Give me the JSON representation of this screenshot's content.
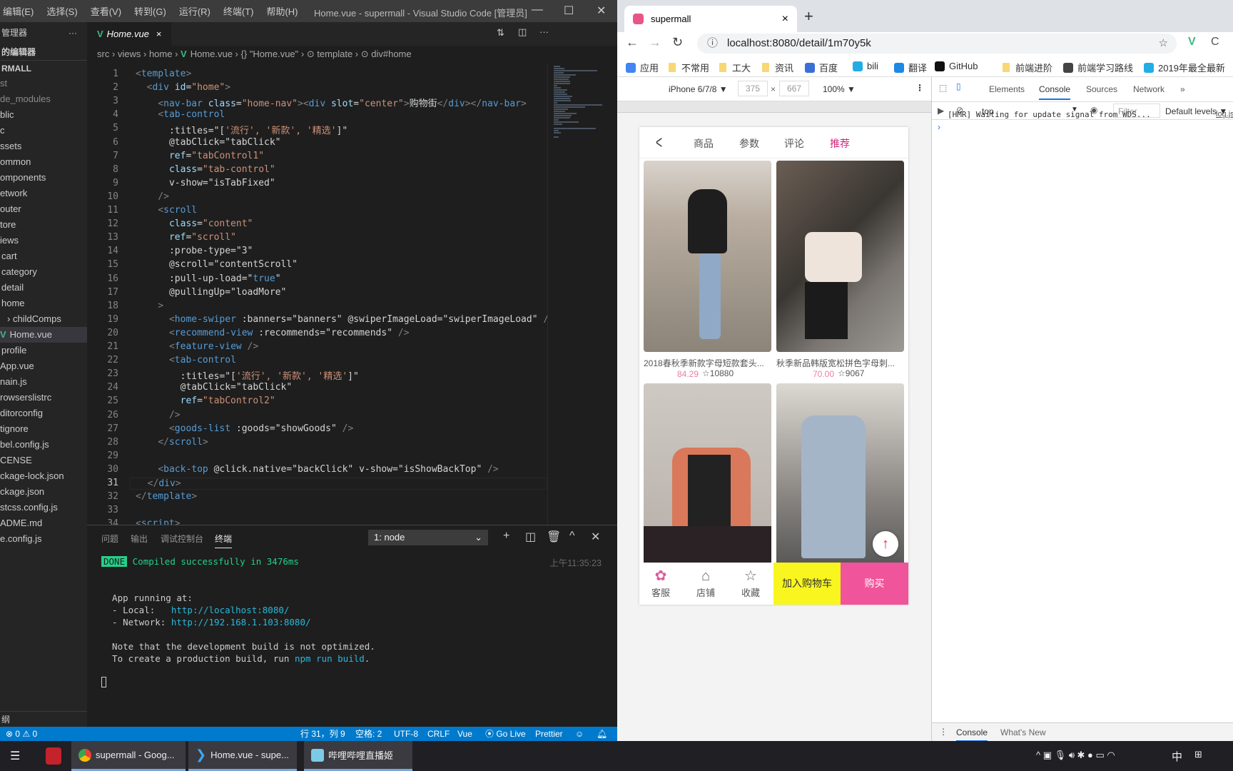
{
  "vscode": {
    "menu": [
      "编辑(E)",
      "选择(S)",
      "查看(V)",
      "转到(G)",
      "运行(R)",
      "终端(T)",
      "帮助(H)"
    ],
    "window_title": "Home.vue - supermall - Visual Studio Code [管理员]",
    "sidebar": {
      "header": "管理器",
      "more": "···",
      "open_editors": "的编辑器",
      "project": "RMALL",
      "items": [
        "st",
        "de_modules",
        "blic",
        "c",
        "ssets",
        "ommon",
        "omponents",
        "etwork",
        "outer",
        "tore",
        "iews",
        "cart",
        "category",
        "detail",
        "home",
        "childComps",
        "Home.vue",
        "profile",
        "App.vue",
        "nain.js",
        "rowserslistrc",
        "ditorconfig",
        "tignore",
        "bel.config.js",
        "CENSE",
        "ckage-lock.json",
        "ckage.json",
        "stcss.config.js",
        "ADME.md",
        "e.config.js"
      ],
      "bottom": "纲"
    },
    "tab": {
      "label": "Home.vue",
      "close": "×"
    },
    "breadcrumb": "src › views › home › ",
    "breadcrumb2": "Home.vue › {} \"Home.vue\" › ⊙ template › ⊙ div#home",
    "current_line": 31,
    "lines": [
      [
        [
          "p",
          "<"
        ],
        [
          "t",
          "template"
        ],
        [
          "p",
          ">"
        ]
      ],
      [
        [
          "x",
          "  "
        ],
        [
          "p",
          "<"
        ],
        [
          "t",
          "div"
        ],
        [
          "a",
          " id"
        ],
        [
          "x",
          "="
        ],
        [
          "s",
          "\"home\""
        ],
        [
          "p",
          ">"
        ]
      ],
      [
        [
          "x",
          "    "
        ],
        [
          "p",
          "<"
        ],
        [
          "t",
          "nav-bar"
        ],
        [
          "a",
          " class"
        ],
        [
          "x",
          "="
        ],
        [
          "s",
          "\"home-nav\""
        ],
        [
          "p",
          "><"
        ],
        [
          "t",
          "div"
        ],
        [
          "a",
          " slot"
        ],
        [
          "x",
          "="
        ],
        [
          "s",
          "\"center\""
        ],
        [
          "p",
          ">"
        ],
        [
          "x",
          "购物街"
        ],
        [
          "p",
          "</"
        ],
        [
          "t",
          "div"
        ],
        [
          "p",
          "></"
        ],
        [
          "t",
          "nav-bar"
        ],
        [
          "p",
          ">"
        ]
      ],
      [
        [
          "x",
          "    "
        ],
        [
          "p",
          "<"
        ],
        [
          "t",
          "tab-control"
        ]
      ],
      [
        [
          "x",
          "      :titles=\"["
        ],
        [
          "s",
          "'流行', '新款', '精选'"
        ],
        [
          "x",
          "]\""
        ]
      ],
      [
        [
          "x",
          "      @tabClick=\"tabClick\""
        ]
      ],
      [
        [
          "a",
          "      ref"
        ],
        [
          "x",
          "="
        ],
        [
          "s",
          "\"tabControl1\""
        ]
      ],
      [
        [
          "a",
          "      class"
        ],
        [
          "x",
          "="
        ],
        [
          "s",
          "\"tab-control\""
        ]
      ],
      [
        [
          "x",
          "      v-show=\"isTabFixed\""
        ]
      ],
      [
        [
          "p",
          "    />"
        ]
      ],
      [
        [
          "x",
          "    "
        ],
        [
          "p",
          "<"
        ],
        [
          "t",
          "scroll"
        ]
      ],
      [
        [
          "a",
          "      class"
        ],
        [
          "x",
          "="
        ],
        [
          "s",
          "\"content\""
        ]
      ],
      [
        [
          "a",
          "      ref"
        ],
        [
          "x",
          "="
        ],
        [
          "s",
          "\"scroll\""
        ]
      ],
      [
        [
          "x",
          "      :probe-type=\"3\""
        ]
      ],
      [
        [
          "x",
          "      @scroll=\"contentScroll\""
        ]
      ],
      [
        [
          "x",
          "      :pull-up-load=\""
        ],
        [
          "t",
          "true"
        ],
        [
          "x",
          "\""
        ]
      ],
      [
        [
          "x",
          "      @pullingUp=\"loadMore\""
        ]
      ],
      [
        [
          "p",
          "    >"
        ]
      ],
      [
        [
          "x",
          "      "
        ],
        [
          "p",
          "<"
        ],
        [
          "t",
          "home-swiper"
        ],
        [
          "x",
          " :banners=\"banners\" @swiperImageLoad=\"swiperImageLoad\" "
        ],
        [
          "p",
          "/>"
        ]
      ],
      [
        [
          "x",
          "      "
        ],
        [
          "p",
          "<"
        ],
        [
          "t",
          "recommend-view"
        ],
        [
          "x",
          " :recommends=\"recommends\" "
        ],
        [
          "p",
          "/>"
        ]
      ],
      [
        [
          "x",
          "      "
        ],
        [
          "p",
          "<"
        ],
        [
          "t",
          "feature-view"
        ],
        [
          "p",
          " />"
        ]
      ],
      [
        [
          "x",
          "      "
        ],
        [
          "p",
          "<"
        ],
        [
          "t",
          "tab-control"
        ]
      ],
      [
        [
          "x",
          "        :titles=\"["
        ],
        [
          "s",
          "'流行', '新款', '精选'"
        ],
        [
          "x",
          "]\""
        ]
      ],
      [
        [
          "x",
          "        @tabClick=\"tabClick\""
        ]
      ],
      [
        [
          "a",
          "        ref"
        ],
        [
          "x",
          "="
        ],
        [
          "s",
          "\"tabControl2\""
        ]
      ],
      [
        [
          "p",
          "      />"
        ]
      ],
      [
        [
          "x",
          "      "
        ],
        [
          "p",
          "<"
        ],
        [
          "t",
          "goods-list"
        ],
        [
          "x",
          " :goods=\"showGoods\" "
        ],
        [
          "p",
          "/>"
        ]
      ],
      [
        [
          "x",
          "    "
        ],
        [
          "p",
          "</"
        ],
        [
          "t",
          "scroll"
        ],
        [
          "p",
          ">"
        ]
      ],
      [],
      [
        [
          "x",
          "    "
        ],
        [
          "p",
          "<"
        ],
        [
          "t",
          "back-top"
        ],
        [
          "x",
          " @click.native=\"backClick\" v-show=\"isShowBackTop\" "
        ],
        [
          "p",
          "/>"
        ]
      ],
      [
        [
          "x",
          "  "
        ],
        [
          "p",
          "</"
        ],
        [
          "t",
          "div"
        ],
        [
          "p",
          ">"
        ]
      ],
      [
        [
          "p",
          "</"
        ],
        [
          "t",
          "template"
        ],
        [
          "p",
          ">"
        ]
      ],
      [],
      [
        [
          "p",
          "<"
        ],
        [
          "t",
          "script"
        ],
        [
          "p",
          ">"
        ]
      ]
    ],
    "panel": {
      "tabs": [
        "问题",
        "输出",
        "调试控制台",
        "终端"
      ],
      "active": "终端",
      "terminal_select": "1: node",
      "done": "DONE",
      "compiled": "Compiled successfully in 3476ms",
      "time": "上午11:35:23",
      "running": "  App running at:",
      "local_label": "  - Local:   ",
      "local_url": "http://localhost:8080/",
      "network_label": "  - Network: ",
      "network_url": "http://192.168.1.103:8080/",
      "note1": "  Note that the development build is not optimized.",
      "note2": "  To create a production build, run ",
      "npm": "npm run build",
      "dot": "."
    },
    "status": {
      "problems": "⊗ 0 ⚠ 0",
      "position": "行 31，列 9",
      "spaces": "空格: 2",
      "encoding": "UTF-8",
      "eol": "CRLF",
      "lang": "Vue",
      "golive": "Go Live",
      "prettier": "Prettier"
    }
  },
  "chrome": {
    "tab_title": "supermall",
    "tab_close": "×",
    "new_tab": "+",
    "url": "localhost:8080/detail/1m70y5k",
    "bookmarks": [
      "应用",
      "不常用",
      "工大",
      "资讯",
      "百度",
      "bili",
      "翻译",
      "GitHub",
      "前端进阶",
      "前端学习路线",
      "2019年最全最新"
    ],
    "device": {
      "name": "iPhone 6/7/8 ▼",
      "width": "375",
      "x": "×",
      "height": "667",
      "zoom": "100% ▼"
    },
    "app": {
      "nav": [
        "商品",
        "参数",
        "评论",
        "推荐"
      ],
      "active_nav": "推荐",
      "goods": [
        {
          "title": "2018春秋季新款字母短款套头...",
          "price": "84.29",
          "collect": "10880"
        },
        {
          "title": "秋季新品韩版宽松拼色字母刺...",
          "price": "70.00",
          "collect": "9067"
        }
      ],
      "bottom": [
        "客服",
        "店铺",
        "收藏"
      ],
      "add_cart": "加入购物车",
      "buy": "购买",
      "accent": "#f0549a",
      "cart_color": "#f9f51e"
    },
    "devtools": {
      "tabs": [
        "Elements",
        "Console",
        "Sources",
        "Network"
      ],
      "more": "»",
      "context": "top",
      "filter": "Filter",
      "levels": "Default levels ▼",
      "message": "[HMR] Waiting for update signal from WDS...",
      "source": "log.js",
      "prompt": "›",
      "drawer": [
        "Console",
        "What's New"
      ]
    }
  },
  "taskbar": {
    "items": [
      "supermall - Goog...",
      "Home.vue - supe...",
      "哔哩哔哩直播姬"
    ],
    "ime": "中"
  }
}
